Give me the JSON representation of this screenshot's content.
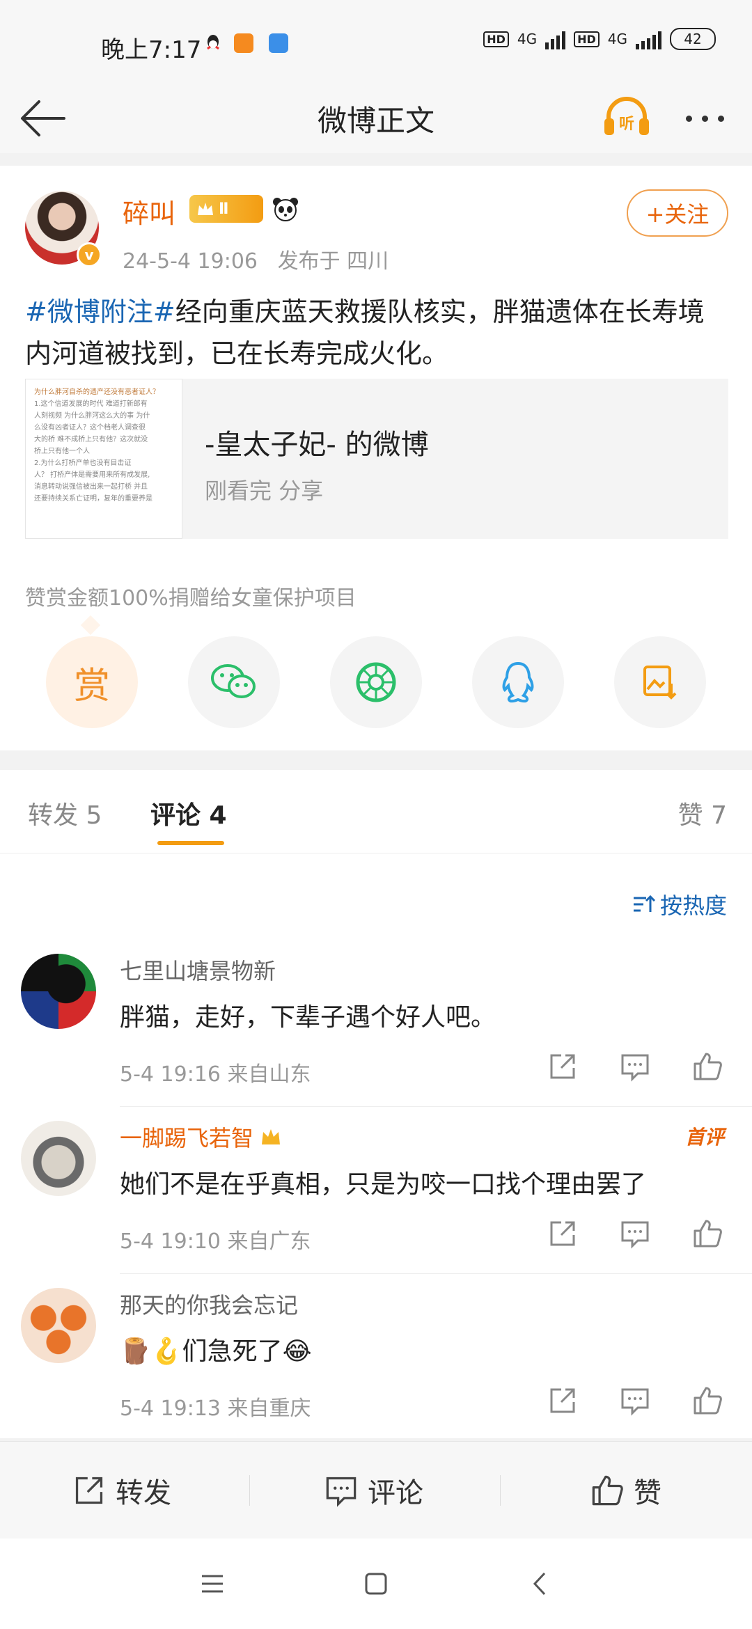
{
  "status_bar": {
    "time": "晚上7:17",
    "hd1": "HD",
    "net1": "4G",
    "hd2": "HD",
    "net2": "4G",
    "battery": "42"
  },
  "nav": {
    "title": "微博正文",
    "listen_label": "听"
  },
  "post": {
    "author": "碎叫",
    "level_badge": "Ⅱ",
    "time": "24-5-4 19:06",
    "location": "发布于 四川",
    "follow_label": "+关注",
    "hashtag": "#微博附注#",
    "text": "经向重庆蓝天救援队核实，胖猫遗体在长寿境内河道被找到，已在长寿完成火化。",
    "shared": {
      "title": "-皇太子妃- 的微博",
      "subtitle": "刚看完 分享",
      "thumb_heading": "为什么胖河自杀的遗产还没有恶者证人？",
      "thumb_lines": [
        "1.这个信道发展的时代 难道打新郎有",
        "人刻视频 为什么胖河这么大的事 为什",
        "么没有凶者证人？这个档老人调查很",
        "大的桥 难不成桥上只有他？这次就没",
        "桥上只有他一个人",
        "2.为什么打桥产单也没有目击证",
        "人？ 打桥产体是需要用来所有成发展,",
        "消息转动说强信被出来一起打桥 并且",
        "还要持续关系亡证明，复年的重要养是"
      ]
    },
    "reward_text": "赞赏金额100%捐赠给女童保护项目",
    "reward_label": "赏"
  },
  "tabs": {
    "repost": "转发 5",
    "comment": "评论 4",
    "like": "赞 7"
  },
  "sort_label": "按热度",
  "comments": [
    {
      "name": "七里山塘景物新",
      "text": "胖猫，走好，下辈子遇个好人吧。",
      "meta": "5-4 19:16 来自山东"
    },
    {
      "name": "一脚踢飞若智",
      "text": "她们不是在乎真相，只是为咬一口找个理由罢了",
      "meta": "5-4 19:10 来自广东",
      "badge": "首评"
    },
    {
      "name": "那天的你我会忘记",
      "emoji_prefix": "🪵🪝",
      "text": "们急死了",
      "emoji_suffix": "😂",
      "meta": "5-4 19:13 来自重庆"
    }
  ],
  "actionbar": {
    "repost": "转发",
    "comment": "评论",
    "like": "赞"
  },
  "colors": {
    "accent": "#e8640b",
    "link": "#1a66b3",
    "orange": "#f39c12"
  }
}
